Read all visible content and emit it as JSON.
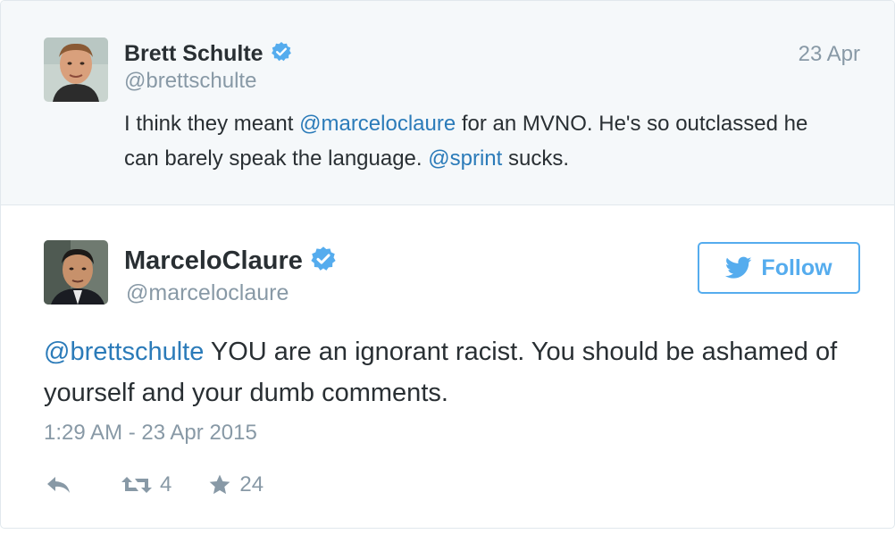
{
  "parent_tweet": {
    "author_name": "Brett Schulte",
    "handle": "@brettschulte",
    "date": "23 Apr",
    "text_parts": {
      "t1": "I think they meant ",
      "mention1": "@marceloclaure",
      "t2": " for an MVNO.  He's so outclassed he can barely speak the language. ",
      "mention2": "@sprint",
      "t3": " sucks."
    }
  },
  "main_tweet": {
    "author_name": "MarceloClaure",
    "handle": "@marceloclaure",
    "follow_label": "Follow",
    "text_parts": {
      "mention1": "@brettschulte",
      "t1": " YOU are an ignorant racist. You should be ashamed of yourself and your dumb comments."
    },
    "timestamp": "1:29 AM - 23 Apr 2015",
    "actions": {
      "retweet_count": "4",
      "favorite_count": "24"
    }
  },
  "colors": {
    "link": "#2b7bb9",
    "twitter_blue": "#55acee",
    "muted": "#8899a6",
    "text": "#292f33",
    "parent_bg": "#f5f8fa"
  },
  "icons": {
    "verified": "verified-badge-icon",
    "bird": "twitter-bird-icon",
    "reply": "reply-icon",
    "retweet": "retweet-icon",
    "favorite": "star-icon"
  }
}
